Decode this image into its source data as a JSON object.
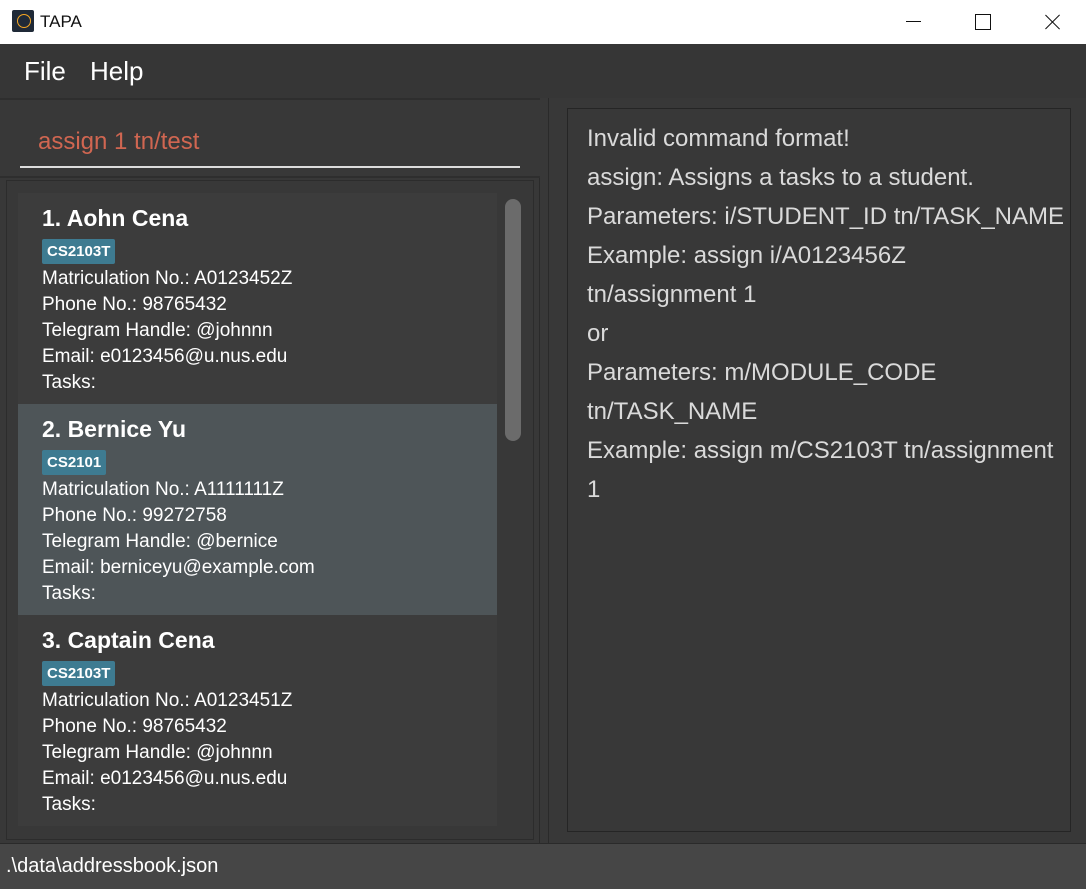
{
  "window": {
    "title": "TAPA",
    "icon": "app-logo-icon"
  },
  "menu": {
    "file": "File",
    "help": "Help"
  },
  "command": {
    "value": "assign 1 tn/test"
  },
  "students": [
    {
      "index_name": "1.  Aohn Cena",
      "tag": "CS2103T",
      "matric": "Matriculation No.: A0123452Z",
      "phone": "Phone No.: 98765432",
      "telegram": "Telegram Handle: @johnnn",
      "email": "Email: e0123456@u.nus.edu",
      "tasks": "Tasks:"
    },
    {
      "index_name": "2.  Bernice Yu",
      "tag": "CS2101",
      "matric": "Matriculation No.: A1111111Z",
      "phone": "Phone No.: 99272758",
      "telegram": "Telegram Handle: @bernice",
      "email": "Email: berniceyu@example.com",
      "tasks": "Tasks:"
    },
    {
      "index_name": "3.  Captain Cena",
      "tag": "CS2103T",
      "matric": "Matriculation No.: A0123451Z",
      "phone": "Phone No.: 98765432",
      "telegram": "Telegram Handle: @johnnn",
      "email": "Email: e0123456@u.nus.edu",
      "tasks": "Tasks:"
    }
  ],
  "result": {
    "lines": [
      "Invalid command format!",
      "assign: Assigns a tasks to a student.",
      "Parameters: i/STUDENT_ID tn/TASK_NAME",
      "Example: assign i/A0123456Z",
      "tn/assignment 1",
      "or",
      "Parameters: m/MODULE_CODE",
      "tn/TASK_NAME",
      "Example: assign m/CS2103T tn/assignment",
      "1"
    ]
  },
  "status": {
    "path": ".\\data\\addressbook.json"
  },
  "colors": {
    "background": "#383838",
    "command_text": "#d06651",
    "tag": "#3e7b91",
    "selected_card": "#4e5558"
  }
}
